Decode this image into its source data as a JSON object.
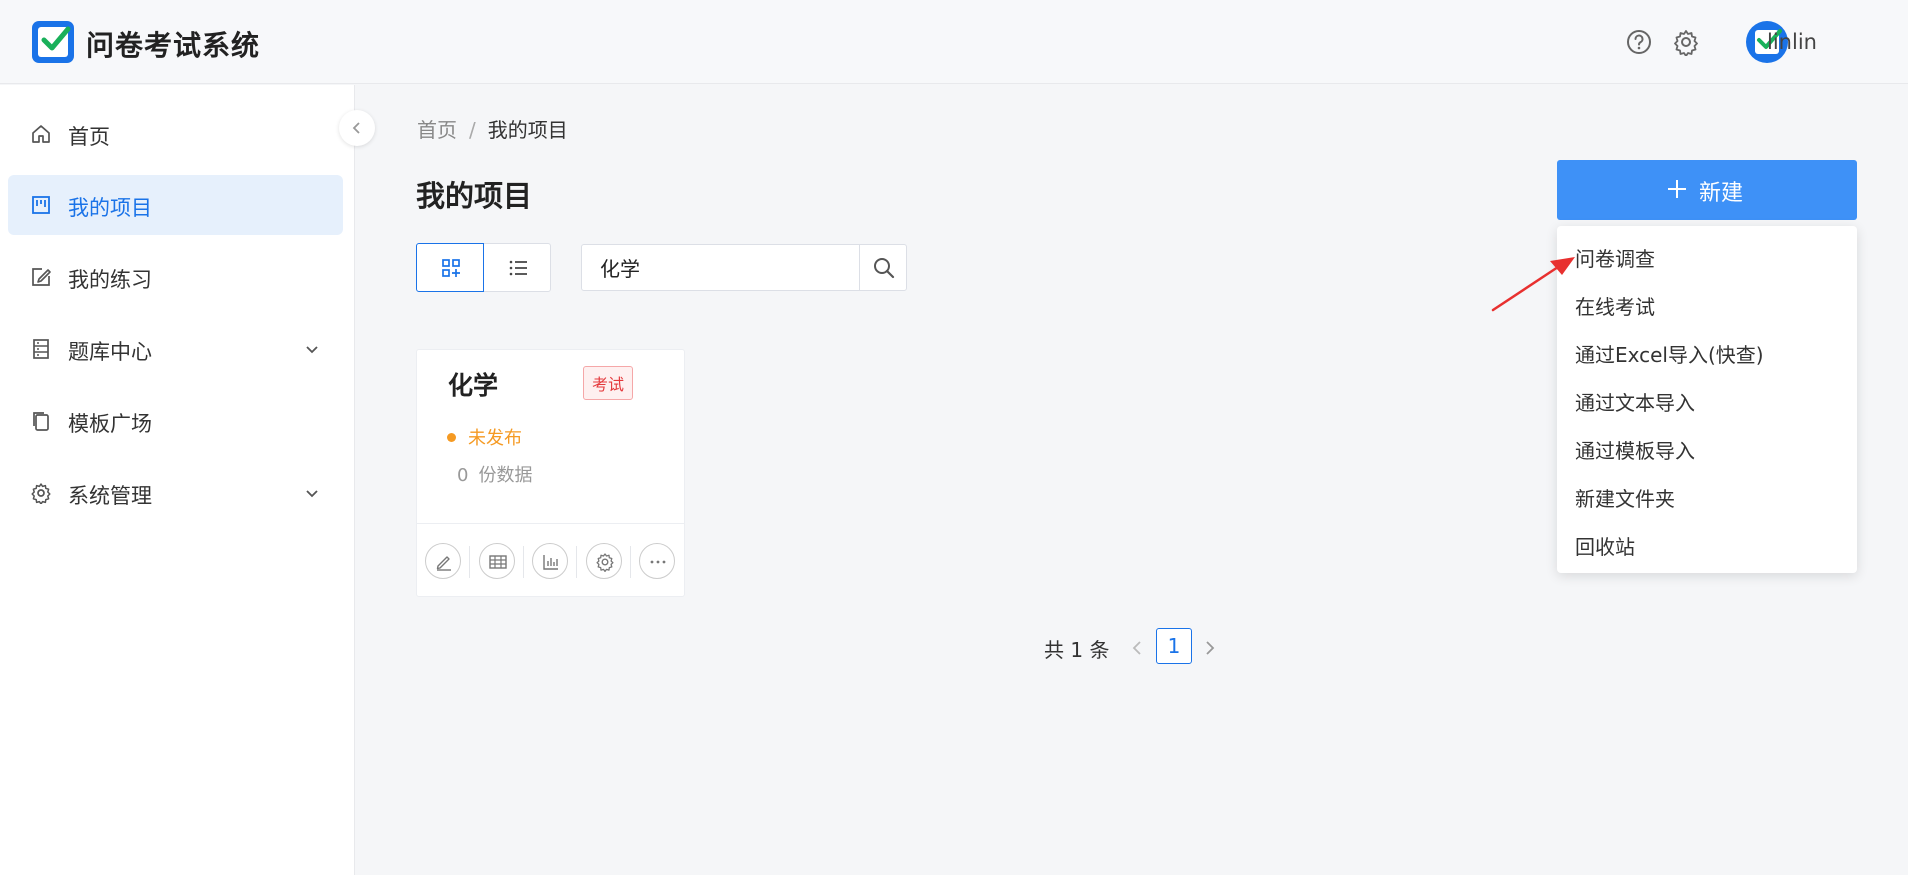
{
  "header": {
    "app_title": "问卷考试系统",
    "help_icon": "help-circle-icon",
    "settings_icon": "gear-icon",
    "username": "linlin"
  },
  "sidebar": {
    "items": [
      {
        "label": "首页",
        "icon": "home-icon"
      },
      {
        "label": "我的项目",
        "icon": "project-board-icon",
        "active": true
      },
      {
        "label": "我的练习",
        "icon": "edit-icon"
      },
      {
        "label": "题库中心",
        "icon": "database-icon",
        "expandable": true
      },
      {
        "label": "模板广场",
        "icon": "copy-icon"
      },
      {
        "label": "系统管理",
        "icon": "gear-icon",
        "expandable": true
      }
    ]
  },
  "breadcrumb": {
    "home": "首页",
    "separator": "/",
    "current": "我的项目"
  },
  "main": {
    "title": "我的项目",
    "search_value": "化学"
  },
  "card": {
    "title": "化学",
    "tag": "考试",
    "status": "未发布",
    "count_value": "0",
    "count_label": "份数据",
    "actions": [
      "edit-icon",
      "table-icon",
      "chart-icon",
      "gear-icon",
      "more-icon"
    ]
  },
  "pagination": {
    "total_text": "共 1 条",
    "current_page": "1"
  },
  "new_button": {
    "label": "新建",
    "menu": [
      "问卷调查",
      "在线考试",
      "通过Excel导入(快查)",
      "通过文本导入",
      "通过模板导入",
      "新建文件夹",
      "回收站"
    ]
  },
  "colors": {
    "primary": "#1a73e8",
    "new_button": "#3e91f7",
    "tag_red": "#e4393c",
    "status_orange": "#f59a23",
    "annotation_arrow": "#e8302f"
  }
}
